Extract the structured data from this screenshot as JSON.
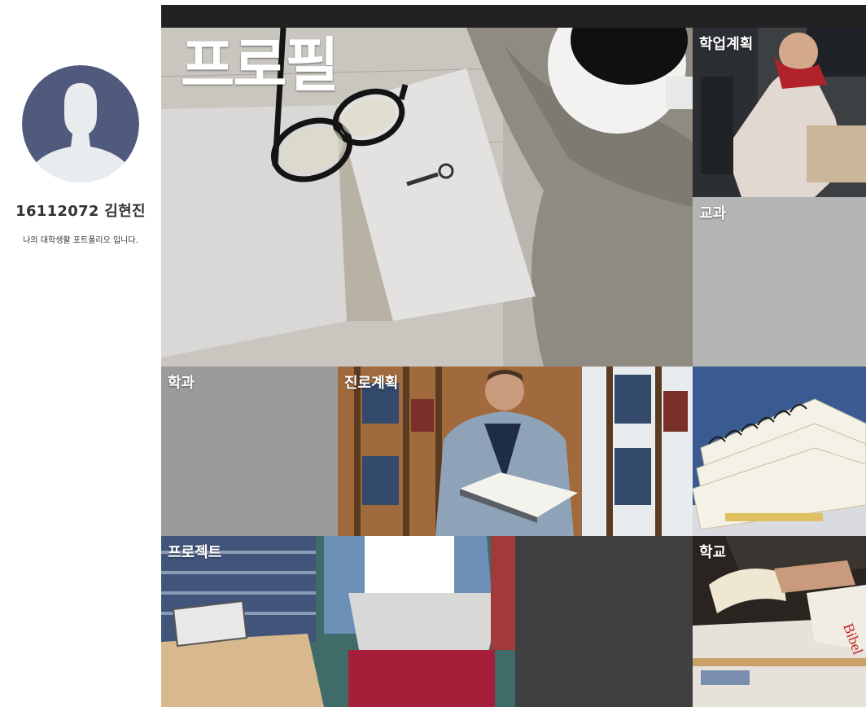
{
  "profile": {
    "student": "16112072 김현진",
    "description": "나의 대학생활 포트폴리오 입니다."
  },
  "tiles": {
    "profile": "프로필",
    "academic_plan": "학업계획",
    "course": "교과",
    "department": "학과",
    "career_plan": "진로계획",
    "project": "프로젝트",
    "school": "학교"
  },
  "colors": {
    "topbar": "#222222",
    "course_tile": "#b5b5b5",
    "department_tile": "#9b9b9b",
    "dark_tile": "#404040",
    "avatar_bg": "#4f5a7d",
    "avatar_figure": "#e8ecef"
  }
}
